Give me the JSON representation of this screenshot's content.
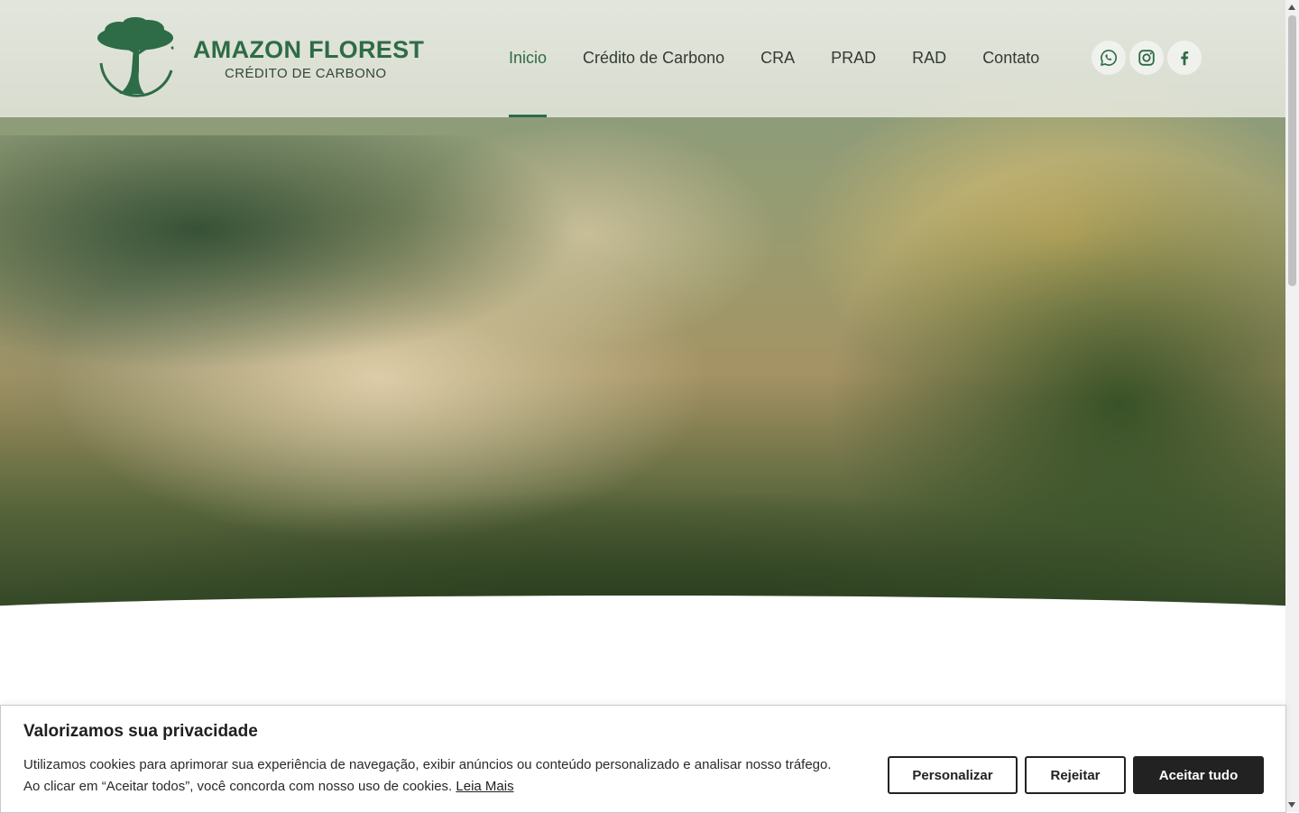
{
  "brand": {
    "name": "AMAZON FLOREST",
    "tagline": "CRÉDITO DE CARBONO"
  },
  "nav": {
    "items": [
      {
        "label": "Inicio",
        "active": true
      },
      {
        "label": "Crédito de Carbono",
        "active": false
      },
      {
        "label": "CRA",
        "active": false
      },
      {
        "label": "PRAD",
        "active": false
      },
      {
        "label": "RAD",
        "active": false
      },
      {
        "label": "Contato",
        "active": false
      }
    ]
  },
  "socials": {
    "items": [
      {
        "icon": "whatsapp-icon"
      },
      {
        "icon": "instagram-icon"
      },
      {
        "icon": "facebook-icon"
      }
    ]
  },
  "colors": {
    "brand_green": "#2e6b47",
    "text_dark": "#222222"
  },
  "cookie": {
    "title": "Valorizamos sua privacidade",
    "text": "Utilizamos cookies para aprimorar sua experiência de navegação, exibir anúncios ou conteúdo personalizado e analisar nosso tráfego. Ao clicar em “Aceitar todos”, você concorda com nosso uso de cookies.",
    "link_label": "Leia Mais",
    "buttons": {
      "customize": "Personalizar",
      "reject": "Rejeitar",
      "accept": "Aceitar tudo"
    }
  }
}
